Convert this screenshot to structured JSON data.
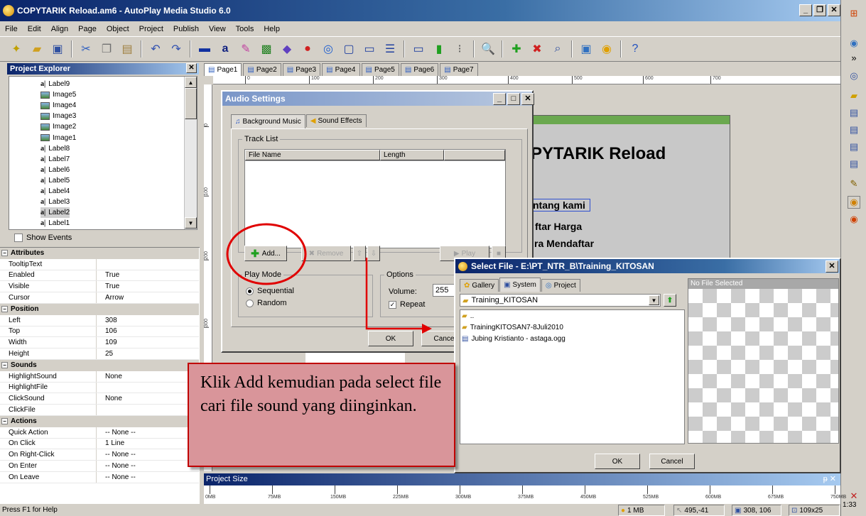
{
  "window": {
    "title": "COPYTARIK Reload.am6 - AutoPlay Media Studio 6.0"
  },
  "menu": [
    "File",
    "Edit",
    "Align",
    "Page",
    "Object",
    "Project",
    "Publish",
    "View",
    "Tools",
    "Help"
  ],
  "explorer": {
    "title": "Project Explorer",
    "items": [
      {
        "type": "label",
        "name": "Label9"
      },
      {
        "type": "image",
        "name": "Image5"
      },
      {
        "type": "image",
        "name": "Image4"
      },
      {
        "type": "image",
        "name": "Image3"
      },
      {
        "type": "image",
        "name": "Image2"
      },
      {
        "type": "image",
        "name": "Image1"
      },
      {
        "type": "label",
        "name": "Label8"
      },
      {
        "type": "label",
        "name": "Label7"
      },
      {
        "type": "label",
        "name": "Label6"
      },
      {
        "type": "label",
        "name": "Label5"
      },
      {
        "type": "label",
        "name": "Label4"
      },
      {
        "type": "label",
        "name": "Label3"
      },
      {
        "type": "label",
        "name": "Label2"
      },
      {
        "type": "label",
        "name": "Label1"
      }
    ],
    "show_events": "Show Events"
  },
  "properties": [
    {
      "cat": "Attributes"
    },
    {
      "k": "TooltipText",
      "v": ""
    },
    {
      "k": "Enabled",
      "v": "True"
    },
    {
      "k": "Visible",
      "v": "True"
    },
    {
      "k": "Cursor",
      "v": "Arrow"
    },
    {
      "cat": "Position"
    },
    {
      "k": "Left",
      "v": "308"
    },
    {
      "k": "Top",
      "v": "106"
    },
    {
      "k": "Width",
      "v": "109"
    },
    {
      "k": "Height",
      "v": "25"
    },
    {
      "cat": "Sounds"
    },
    {
      "k": "HighlightSound",
      "v": "None"
    },
    {
      "k": "HighlightFile",
      "v": ""
    },
    {
      "k": "ClickSound",
      "v": "None"
    },
    {
      "k": "ClickFile",
      "v": ""
    },
    {
      "cat": "Actions"
    },
    {
      "k": "Quick Action",
      "v": "-- None --"
    },
    {
      "k": "On Click",
      "v": "1 Line"
    },
    {
      "k": "On Right-Click",
      "v": "-- None --"
    },
    {
      "k": "On Enter",
      "v": "-- None --"
    },
    {
      "k": "On Leave",
      "v": "-- None --"
    }
  ],
  "pages": [
    "Page1",
    "Page2",
    "Page3",
    "Page4",
    "Page5",
    "Page6",
    "Page7"
  ],
  "ruler_h": [
    "100",
    "0",
    "100",
    "200",
    "300",
    "400",
    "500",
    "600",
    "700"
  ],
  "ruler_v": [
    "0",
    "100",
    "200",
    "300"
  ],
  "canvas": {
    "heading": "PYTARIK Reload",
    "link1": "ntang kami",
    "link2": "ftar Harga",
    "link3": "ra Mendaftar"
  },
  "audio": {
    "title": "Audio Settings",
    "tab_bg": "Background Music",
    "tab_fx": "Sound Effects",
    "tracklist": "Track List",
    "col_file": "File Name",
    "col_length": "Length",
    "add": "Add...",
    "remove": "Remove",
    "play": "Play",
    "playmode": "Play Mode",
    "sequential": "Sequential",
    "random": "Random",
    "options": "Options",
    "volume_label": "Volume:",
    "volume": "255",
    "repeat": "Repeat",
    "ok": "OK",
    "cancel": "Cance"
  },
  "select_file": {
    "title": "Select File - E:\\PT_NTR_B\\Training_KITOSAN",
    "tab_gallery": "Gallery",
    "tab_system": "System",
    "tab_project": "Project",
    "folder": "Training_KITOSAN",
    "items": [
      "..",
      "TrainingKITOSAN7-8Juli2010",
      "Jubing Kristianto - astaga.ogg"
    ],
    "preview": "No File Selected",
    "ok": "OK",
    "cancel": "Cancel"
  },
  "callout": {
    "text": "Klik Add kemudian pada select file cari file sound yang diinginkan."
  },
  "project_size": {
    "title": "Project Size",
    "ticks": [
      "0MB",
      "75MB",
      "150MB",
      "225MB",
      "300MB",
      "375MB",
      "450MB",
      "525MB",
      "600MB",
      "675MB",
      "750MB"
    ]
  },
  "status": {
    "help": "Press F1 for Help",
    "size": "1 MB",
    "cursor": "495,-41",
    "pos": "308, 106",
    "dim": "109x25"
  },
  "clock": "1:33",
  "colors": {
    "titlebar": "#0a246a",
    "callout_bg": "#d9959a",
    "callout_border": "#c00000",
    "annotation": "#e00000"
  }
}
